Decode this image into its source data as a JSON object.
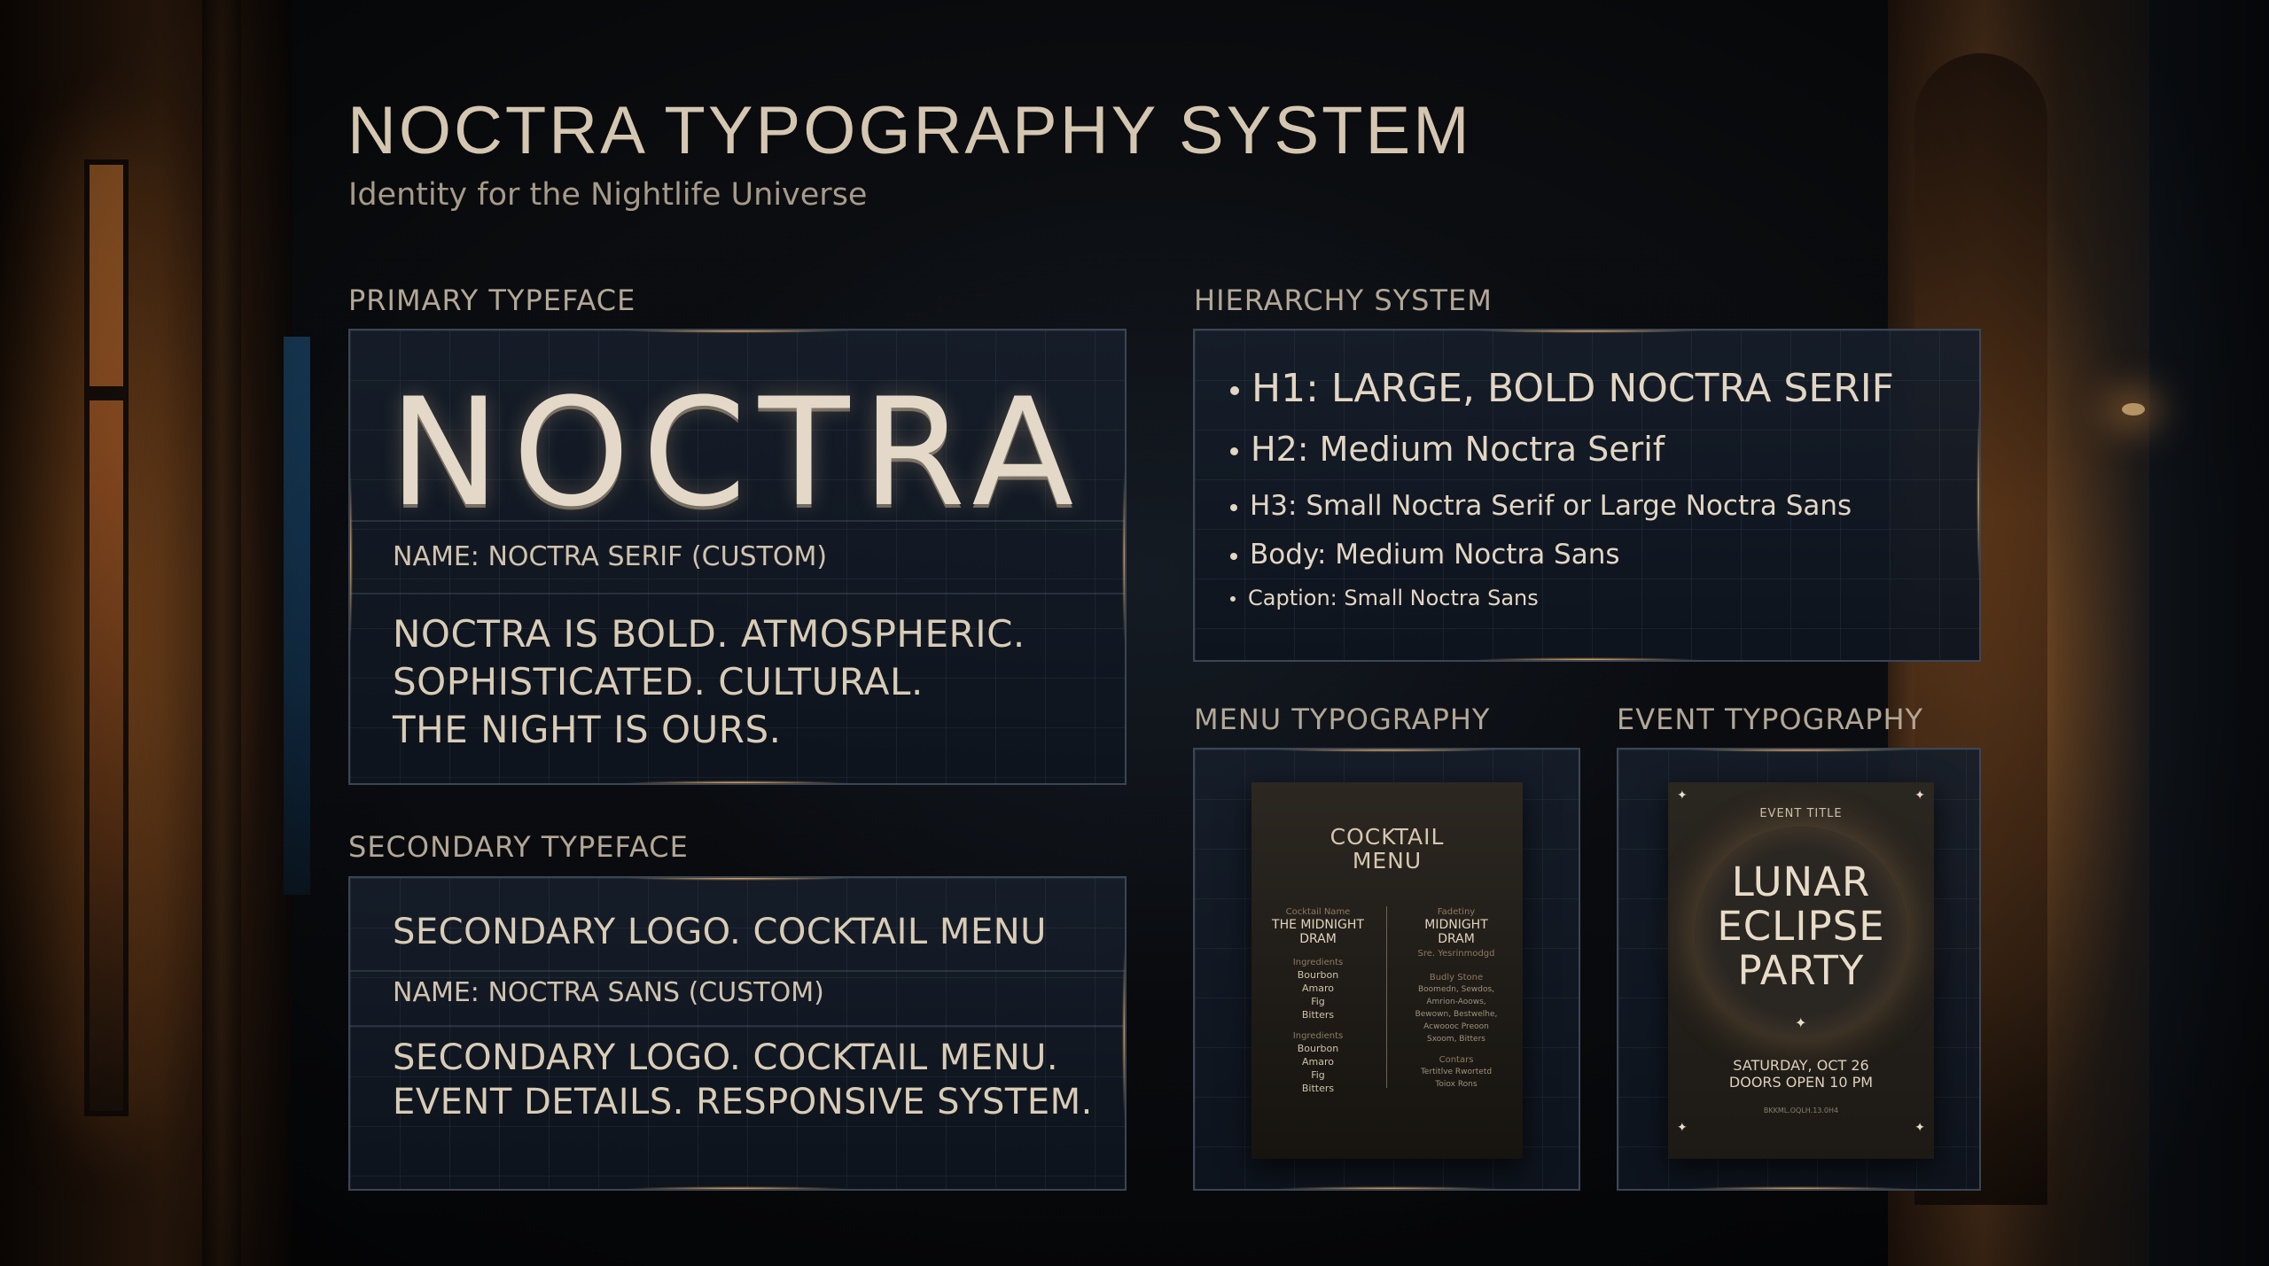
{
  "header": {
    "title": "NOCTRA TYPOGRAPHY SYSTEM",
    "subtitle": "Identity for the Nightlife Universe"
  },
  "sections": {
    "primary_label": "PRIMARY TYPEFACE",
    "secondary_label": "SECONDARY TYPEFACE",
    "hierarchy_label": "HIERARCHY SYSTEM",
    "menu_label": "MENU TYPOGRAPHY",
    "event_label": "EVENT TYPOGRAPHY"
  },
  "primary": {
    "logo": "NOCTRA",
    "name": "NAME: NOCTRA SERIF (CUSTOM)",
    "statement_lines": [
      "NOCTRA IS BOLD. ATMOSPHERIC.",
      "SOPHISTICATED. CULTURAL.",
      "THE NIGHT IS OURS."
    ]
  },
  "secondary": {
    "heading": "SECONDARY LOGO. COCKTAIL MENU",
    "name": "NAME: NOCTRA SANS (CUSTOM)",
    "statement_lines": [
      "SECONDARY LOGO. COCKTAIL MENU.",
      "EVENT DETAILS. RESPONSIVE SYSTEM."
    ]
  },
  "hierarchy": {
    "items": [
      "H1: LARGE, BOLD NOCTRA SERIF",
      "H2: Medium Noctra Serif",
      "H3: Small Noctra Serif or Large Noctra Sans",
      "Body: Medium Noctra Sans",
      "Caption: Small Noctra Sans"
    ]
  },
  "menu": {
    "title_lines": [
      "COCKTAIL",
      "MENU"
    ],
    "left": {
      "kicker": "Cocktail Name",
      "name_lines": [
        "THE MIDNIGHT",
        "DRAM"
      ],
      "ingredients_label": "Ingredients",
      "ingredients": [
        "Bourbon",
        "Amaro",
        "Fig",
        "Bitters"
      ],
      "ingredients_label_2": "Ingredients",
      "ingredients_2": [
        "Bourbon",
        "Amaro",
        "Fig",
        "Bitters"
      ]
    },
    "right": {
      "kicker": "Fadetiny",
      "name_lines": [
        "MIDNIGHT",
        "DRAM"
      ],
      "sub": "Sre. Yesrinmodgd",
      "list_label": "Budly Stone",
      "list": [
        "Boomedn, Sewdos,",
        "Amrion-Aoows,",
        "Bewown, Bestwelhe,",
        "Acwoooc Preoon",
        "Sxoom, Bitters"
      ],
      "list_label_2": "Contars",
      "list_2": [
        "Tertitlve Rwortetd",
        "Toiox Rons"
      ]
    }
  },
  "event": {
    "kicker": "EVENT TITLE",
    "title_lines": [
      "LUNAR",
      "ECLIPSE",
      "PARTY"
    ],
    "date_lines": [
      "SATURDAY, OCT 26",
      "DOORS OPEN 10 PM"
    ],
    "fine_print": "BKKML.OQLH.13.0H4"
  },
  "colors": {
    "accent_glow": "#ffbe6e",
    "text_primary": "#d8cbb7",
    "panel_border": "#3b4654"
  }
}
